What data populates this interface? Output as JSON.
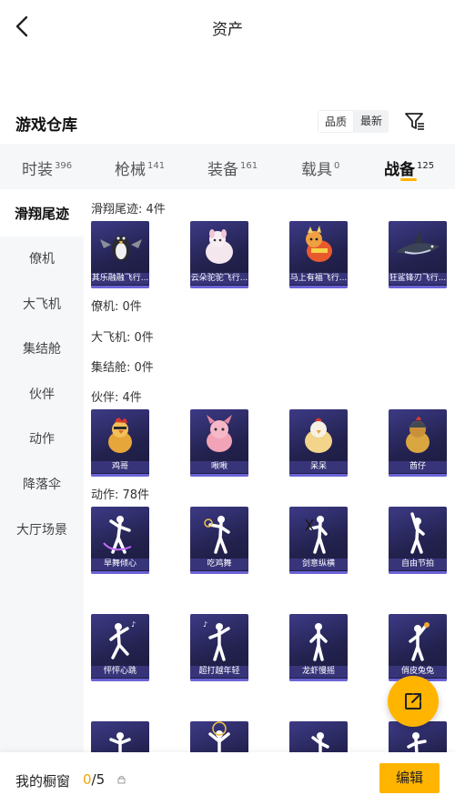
{
  "nav": {
    "title": "资产"
  },
  "warehouse": {
    "title": "游戏仓库",
    "sort_options": [
      "品质",
      "最新"
    ],
    "active_sort": "品质"
  },
  "tabs": [
    {
      "label": "时装",
      "count": "396"
    },
    {
      "label": "枪械",
      "count": "141"
    },
    {
      "label": "装备",
      "count": "161"
    },
    {
      "label": "载具",
      "count": "0"
    },
    {
      "label": "战备",
      "count": "125",
      "active": true
    }
  ],
  "sidebar": {
    "items": [
      {
        "label": "滑翔尾迹",
        "active": true
      },
      {
        "label": "僚机"
      },
      {
        "label": "大飞机"
      },
      {
        "label": "集结舱"
      },
      {
        "label": "伙伴"
      },
      {
        "label": "动作"
      },
      {
        "label": "降落伞"
      },
      {
        "label": "大厅场景"
      }
    ]
  },
  "sections": {
    "trail": {
      "label": "滑翔尾迹: 4件",
      "items": [
        "其乐融融飞行...",
        "云朵驼驼飞行...",
        "马上有福飞行...",
        "狂鲨锋刃飞行..."
      ]
    },
    "wingman": {
      "label": "僚机: 0件"
    },
    "plane": {
      "label": "大飞机: 0件"
    },
    "pod": {
      "label": "集结舱: 0件"
    },
    "partner": {
      "label": "伙伴: 4件",
      "items": [
        "鸡哥",
        "啾啾",
        "呆呆",
        "酋仔"
      ]
    },
    "emote": {
      "label": "动作: 78件",
      "items": [
        "旱舞倾心",
        "吃鸡舞",
        "剑意纵横",
        "自由节拍",
        "怦怦心跳",
        "超打越年轻",
        "龙虾慢摇",
        "俏皮兔兔"
      ]
    }
  },
  "bottom": {
    "label": "我的橱窗",
    "current": "0",
    "total": "/5",
    "edit_label": "编辑"
  },
  "colors": {
    "accent": "#ffb400",
    "card_bg": "#2a2860",
    "caption_bg": "#3c3882"
  }
}
